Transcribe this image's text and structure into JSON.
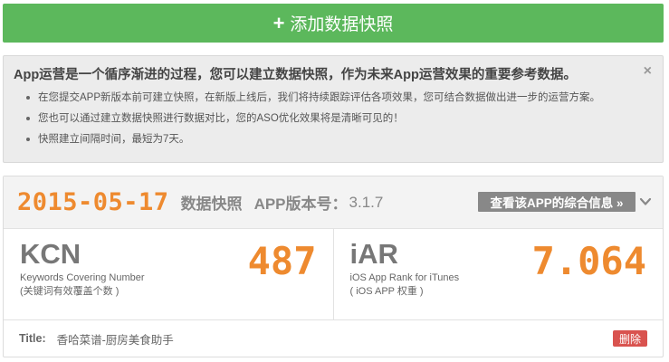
{
  "add_button": {
    "icon": "plus-icon",
    "label": "添加数据快照"
  },
  "notice": {
    "title": "App运营是一个循序渐进的过程，您可以建立数据快照，作为未来App运营效果的重要参考数据。",
    "items": [
      "在您提交APP新版本前可建立快照，在新版上线后，我们将持续跟踪评估各项效果，您可结合数据做出进一步的运营方案。",
      "您也可以通过建立数据快照进行数据对比，您的ASO优化效果将是清晰可见的！",
      "快照建立间隔时间，最短为7天。"
    ],
    "close_label": "×"
  },
  "snapshot": {
    "date": "2015-05-17",
    "label": "数据快照",
    "version_label": "APP版本号：",
    "version": "3.1.7",
    "info_button": "查看该APP的综合信息 »",
    "metrics": [
      {
        "name": "KCN",
        "desc": "Keywords Covering Number",
        "sub": "(关键词有效覆盖个数 )",
        "value": "487"
      },
      {
        "name": "iAR",
        "desc": "iOS App Rank for iTunes",
        "sub": "( iOS APP 权重 )",
        "value": "7.064"
      }
    ],
    "title_label": "Title:",
    "title_value": "香哈菜谱-厨房美食助手",
    "delete_button": "删除"
  },
  "colors": {
    "accent": "#ee8a2f",
    "success": "#5cb85c",
    "danger": "#d9534f"
  }
}
